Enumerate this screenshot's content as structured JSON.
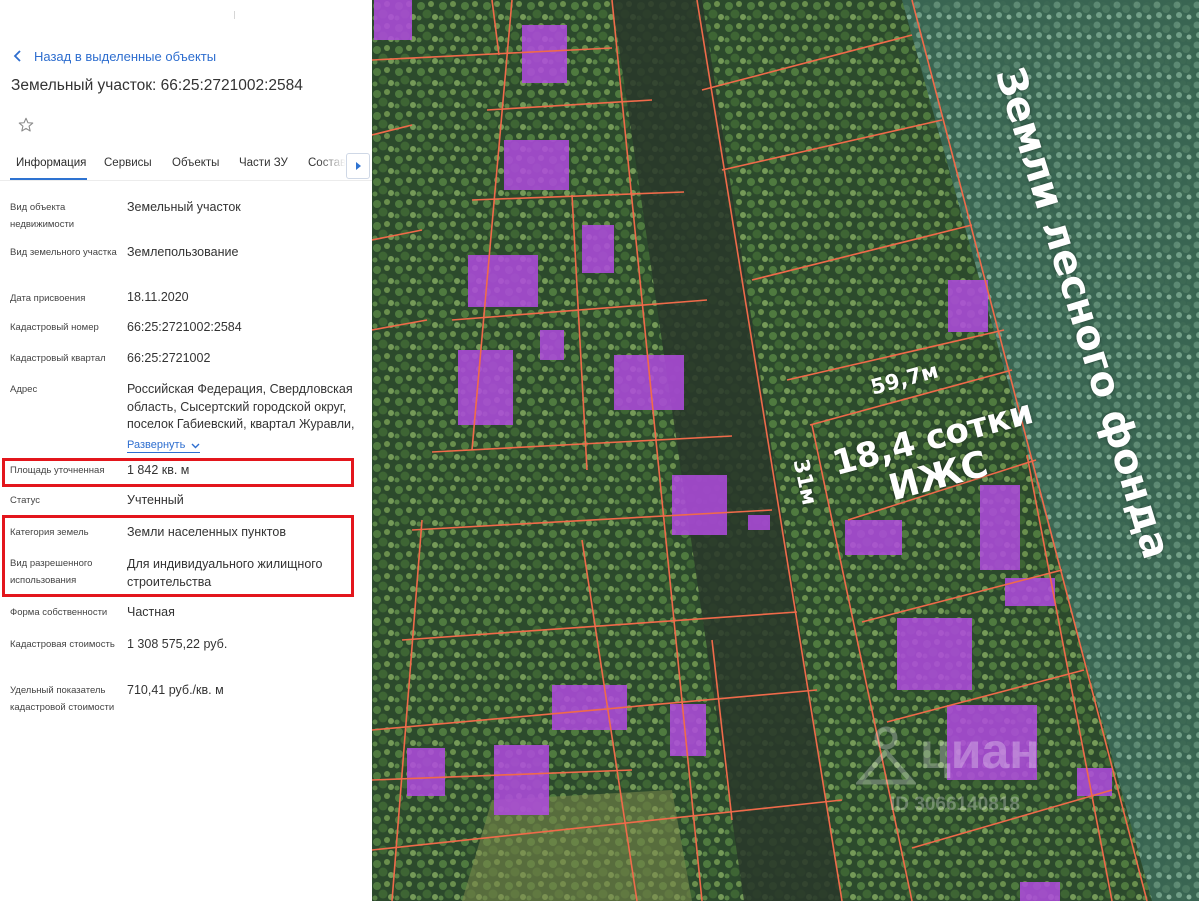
{
  "panel": {
    "back_label": "Назад в выделенные объекты",
    "title": "Земельный участок: 66:25:2721002:2584",
    "tabs": [
      {
        "label": "Информация"
      },
      {
        "label": "Сервисы"
      },
      {
        "label": "Объекты"
      },
      {
        "label": "Части ЗУ"
      },
      {
        "label": "Состав"
      }
    ],
    "fields": [
      {
        "label": "Вид объекта недвижимости",
        "value": "Земельный участок"
      },
      {
        "label": "Вид земельного участка",
        "value": "Землепользование"
      },
      {
        "label": "Дата присвоения",
        "value": "18.11.2020"
      },
      {
        "label": "Кадастровый номер",
        "value": "66:25:2721002:2584"
      },
      {
        "label": "Кадастровый квартал",
        "value": "66:25:2721002"
      },
      {
        "label": "Адрес",
        "value": "Российская Федерация, Свердловская область, Сысертский городской округ, поселок Габиевский, квартал Журавли,"
      },
      {
        "label": "Площадь уточненная",
        "value": "1 842 кв. м"
      },
      {
        "label": "Статус",
        "value": "Учтенный"
      },
      {
        "label": "Категория земель",
        "value": "Земли населенных пунктов"
      },
      {
        "label": "Вид разрешенного использования",
        "value": "Для индивидуального жилищного строительства"
      },
      {
        "label": "Форма собственности",
        "value": "Частная"
      },
      {
        "label": "Кадастровая стоимость",
        "value": "1 308 575,22 руб."
      },
      {
        "label": "Удельный показатель кадастровой стоимости",
        "value": "710,41 руб./кв. м"
      }
    ],
    "expand_label": "Развернуть"
  },
  "map": {
    "width_label": "59,7м",
    "depth_label": "31м",
    "area_label": "18,4 сотки",
    "type_label": "ИЖС",
    "forest_label": "Земли лесного фонда",
    "watermark_brand": "циан",
    "watermark_id": "ID 3066140818"
  },
  "colors": {
    "link": "#2e6ecf",
    "highlight": "#e3161c",
    "parcel_line": "#f06a4a",
    "building": "#b14be0"
  }
}
